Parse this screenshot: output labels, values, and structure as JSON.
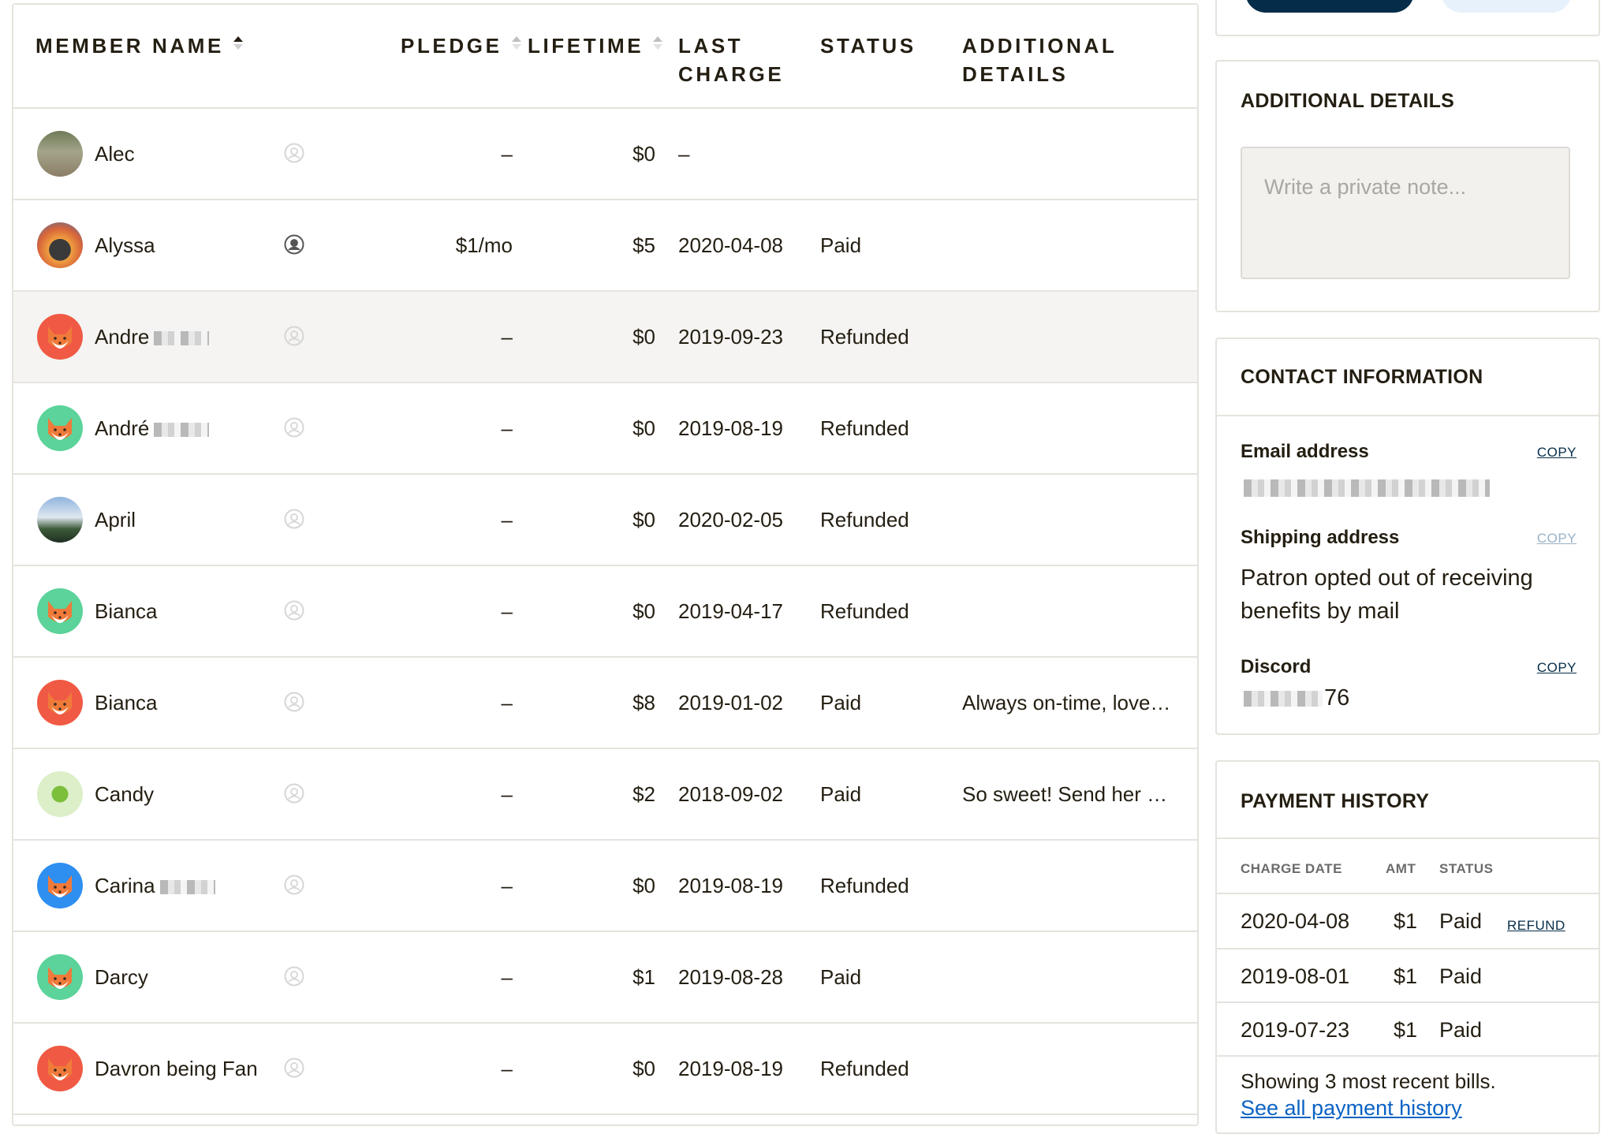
{
  "table": {
    "columns": {
      "member_name": "MEMBER NAME",
      "pledge": "PLEDGE",
      "lifetime": "LIFETIME",
      "last_charge_line1": "LAST",
      "last_charge_line2": "CHARGE",
      "status": "STATUS",
      "details_line1": "ADDITIONAL",
      "details_line2": "DETAILS"
    },
    "rows": [
      {
        "name": "Alec",
        "pledge": "–",
        "lifetime": "$0",
        "last_charge": "–",
        "status": "",
        "details": ""
      },
      {
        "name": "Alyssa",
        "pledge": "$1/mo",
        "lifetime": "$5",
        "last_charge": "2020-04-08",
        "status": "Paid",
        "details": ""
      },
      {
        "name": "Andre",
        "pledge": "–",
        "lifetime": "$0",
        "last_charge": "2019-09-23",
        "status": "Refunded",
        "details": ""
      },
      {
        "name": "André",
        "pledge": "–",
        "lifetime": "$0",
        "last_charge": "2019-08-19",
        "status": "Refunded",
        "details": ""
      },
      {
        "name": "April",
        "pledge": "–",
        "lifetime": "$0",
        "last_charge": "2020-02-05",
        "status": "Refunded",
        "details": ""
      },
      {
        "name": "Bianca",
        "pledge": "–",
        "lifetime": "$0",
        "last_charge": "2019-04-17",
        "status": "Refunded",
        "details": ""
      },
      {
        "name": "Bianca",
        "pledge": "–",
        "lifetime": "$8",
        "last_charge": "2019-01-02",
        "status": "Paid",
        "details": "Always on-time, love…"
      },
      {
        "name": "Candy",
        "pledge": "–",
        "lifetime": "$2",
        "last_charge": "2018-09-02",
        "status": "Paid",
        "details": "So sweet! Send her …"
      },
      {
        "name": "Carina",
        "pledge": "–",
        "lifetime": "$0",
        "last_charge": "2019-08-19",
        "status": "Refunded",
        "details": ""
      },
      {
        "name": "Darcy",
        "pledge": "–",
        "lifetime": "$1",
        "last_charge": "2019-08-28",
        "status": "Paid",
        "details": ""
      },
      {
        "name": "Davron being Fan",
        "pledge": "–",
        "lifetime": "$0",
        "last_charge": "2019-08-19",
        "status": "Refunded",
        "details": ""
      }
    ]
  },
  "sidebar": {
    "additional_details": {
      "title": "ADDITIONAL DETAILS",
      "note_placeholder": "Write a private note..."
    },
    "contact": {
      "title": "CONTACT INFORMATION",
      "email_label": "Email address",
      "copy_label": "COPY",
      "shipping_label": "Shipping address",
      "shipping_value": "Patron opted out of receiving benefits by mail",
      "discord_label": "Discord",
      "discord_suffix": "76"
    },
    "payment_history": {
      "title": "PAYMENT HISTORY",
      "headers": {
        "date": "CHARGE DATE",
        "amount": "AMT",
        "status": "STATUS"
      },
      "rows": [
        {
          "date": "2020-04-08",
          "amount": "$1",
          "status": "Paid",
          "action": "REFUND"
        },
        {
          "date": "2019-08-01",
          "amount": "$1",
          "status": "Paid",
          "action": ""
        },
        {
          "date": "2019-07-23",
          "amount": "$1",
          "status": "Paid",
          "action": ""
        }
      ],
      "footer_text": "Showing 3 most recent bills.",
      "footer_link": "See all payment history"
    }
  },
  "colors": {
    "text": "#241e12",
    "border": "#e5e3dd",
    "highlight_row": "#f5f4f2",
    "primary_button": "#052d49",
    "link": "#0b63c4",
    "avatar_red": "#f05a44",
    "avatar_green": "#5bd39a",
    "avatar_blue": "#2e8ff0"
  }
}
